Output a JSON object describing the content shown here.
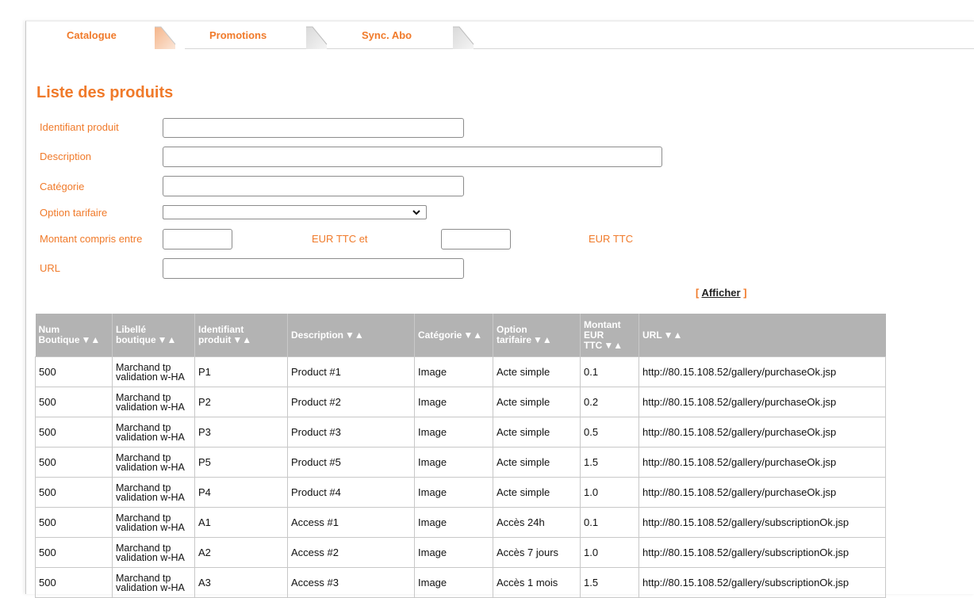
{
  "tabs": [
    {
      "label": "Catalogue",
      "active": true
    },
    {
      "label": "Promotions",
      "active": false
    },
    {
      "label": "Sync. Abo",
      "active": false
    }
  ],
  "page_title": "Liste des produits",
  "form": {
    "product_id_label": "Identifiant produit",
    "product_id_value": "",
    "description_label": "Description",
    "description_value": "",
    "category_label": "Catégorie",
    "category_value": "",
    "price_option_label": "Option tarifaire",
    "price_option_value": "",
    "amount_label": "Montant compris entre",
    "amount_min_value": "",
    "amount_mid_label": "EUR TTC et",
    "amount_max_value": "",
    "amount_end_label": "EUR TTC",
    "url_label": "URL",
    "url_value": "",
    "submit_open": "[ ",
    "submit_label": "Afficher",
    "submit_close": " ]"
  },
  "table": {
    "sort_glyph": "▼▲",
    "headers": [
      {
        "line1": "Num",
        "line2": "Boutique",
        "line3": ""
      },
      {
        "line1": "Libellé",
        "line2": "boutique",
        "line3": ""
      },
      {
        "line1": "Identifiant",
        "line2": "produit",
        "line3": ""
      },
      {
        "line1": "",
        "line2": "Description",
        "line3": ""
      },
      {
        "line1": "",
        "line2": "Catégorie",
        "line3": ""
      },
      {
        "line1": "Option",
        "line2": "tarifaire",
        "line3": ""
      },
      {
        "line1": "Montant",
        "line2": "EUR",
        "line3": "TTC"
      },
      {
        "line1": "",
        "line2": "URL",
        "line3": ""
      }
    ],
    "rows": [
      [
        "500",
        "Marchand tp validation w-HA",
        "P1",
        "Product #1",
        "Image",
        "Acte simple",
        "0.1",
        "http://80.15.108.52/gallery/purchaseOk.jsp"
      ],
      [
        "500",
        "Marchand tp validation w-HA",
        "P2",
        "Product #2",
        "Image",
        "Acte simple",
        "0.2",
        "http://80.15.108.52/gallery/purchaseOk.jsp"
      ],
      [
        "500",
        "Marchand tp validation w-HA",
        "P3",
        "Product #3",
        "Image",
        "Acte simple",
        "0.5",
        "http://80.15.108.52/gallery/purchaseOk.jsp"
      ],
      [
        "500",
        "Marchand tp validation w-HA",
        "P5",
        "Product #5",
        "Image",
        "Acte simple",
        "1.5",
        "http://80.15.108.52/gallery/purchaseOk.jsp"
      ],
      [
        "500",
        "Marchand tp validation w-HA",
        "P4",
        "Product #4",
        "Image",
        "Acte simple",
        "1.0",
        "http://80.15.108.52/gallery/purchaseOk.jsp"
      ],
      [
        "500",
        "Marchand tp validation w-HA",
        "A1",
        "Access #1",
        "Image",
        "Accès 24h",
        "0.1",
        "http://80.15.108.52/gallery/subscriptionOk.jsp"
      ],
      [
        "500",
        "Marchand tp validation w-HA",
        "A2",
        "Access #2",
        "Image",
        "Accès 7 jours",
        "1.0",
        "http://80.15.108.52/gallery/subscriptionOk.jsp"
      ],
      [
        "500",
        "Marchand tp validation w-HA",
        "A3",
        "Access #3",
        "Image",
        "Accès 1 mois",
        "1.5",
        "http://80.15.108.52/gallery/subscriptionOk.jsp"
      ]
    ]
  },
  "colors": {
    "accent": "#f07a2a",
    "header_bg": "#b3b3b3",
    "grid_border": "#c8c8c8"
  }
}
